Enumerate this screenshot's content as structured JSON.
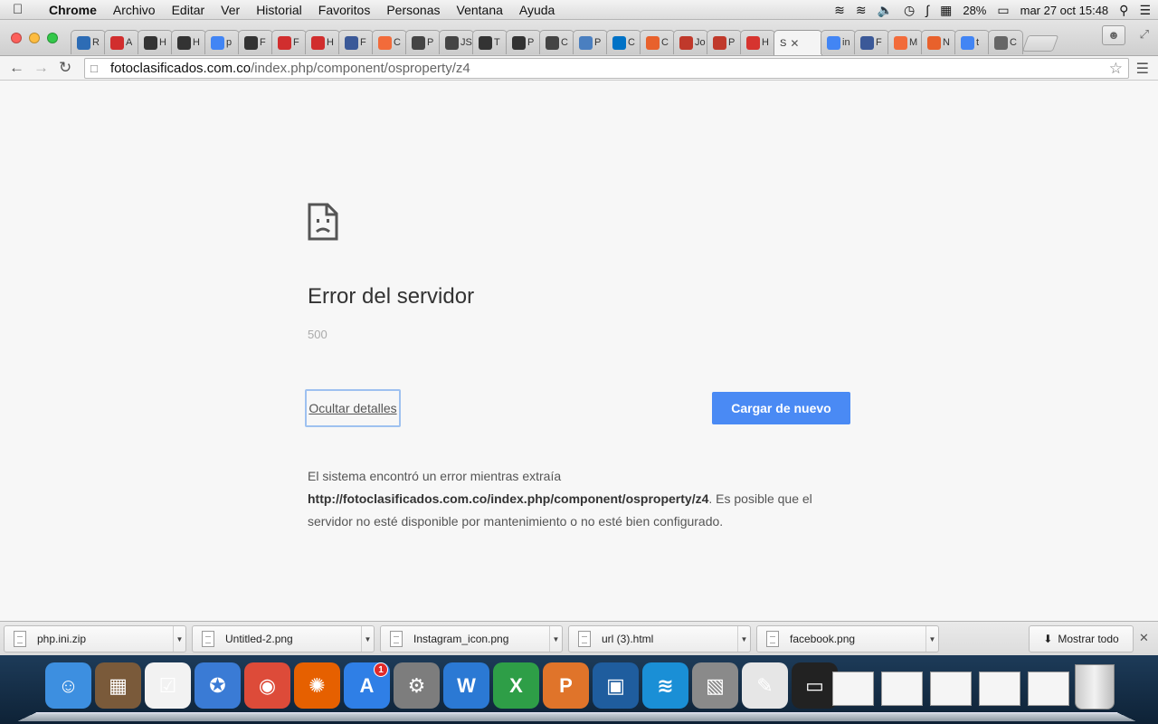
{
  "menubar": {
    "app_name": "Chrome",
    "items": [
      "Archivo",
      "Editar",
      "Ver",
      "Historial",
      "Favoritos",
      "Personas",
      "Ventana",
      "Ayuda"
    ],
    "status": {
      "battery": "28%",
      "datetime": "mar 27 oct  15:48"
    }
  },
  "tabs": [
    {
      "label": "R",
      "icon": "globe-icon",
      "color": "#2d6cb5"
    },
    {
      "label": "A",
      "icon": "pause-red-icon",
      "color": "#d12e2e"
    },
    {
      "label": "H",
      "icon": "joomla-icon",
      "color": "#333333"
    },
    {
      "label": "H",
      "icon": "joomla-icon",
      "color": "#333333"
    },
    {
      "label": "p",
      "icon": "google-icon",
      "color": "#4285f4"
    },
    {
      "label": "F",
      "icon": "joomla-icon",
      "color": "#333333"
    },
    {
      "label": "F",
      "icon": "pause-red-icon",
      "color": "#d12e2e"
    },
    {
      "label": "H",
      "icon": "pause-red-icon",
      "color": "#d12e2e"
    },
    {
      "label": "F",
      "icon": "facebook-icon",
      "color": "#3b5998"
    },
    {
      "label": "C",
      "icon": "joomla-color-icon",
      "color": "#f26b3a"
    },
    {
      "label": "P",
      "icon": "check-circle-icon",
      "color": "#444444"
    },
    {
      "label": "JS",
      "icon": "check-circle-icon",
      "color": "#444444"
    },
    {
      "label": "T",
      "icon": "joomla-icon",
      "color": "#333333"
    },
    {
      "label": "P",
      "icon": "joomla-icon",
      "color": "#333333"
    },
    {
      "label": "C",
      "icon": "check-circle-icon",
      "color": "#444444"
    },
    {
      "label": "P",
      "icon": "cloud-icon",
      "color": "#4a7fc0"
    },
    {
      "label": "C",
      "icon": "outlook-icon",
      "color": "#0072c6"
    },
    {
      "label": "C",
      "icon": "os-icon",
      "color": "#e8612c"
    },
    {
      "label": "Jo",
      "icon": "puzzle-icon",
      "color": "#c0392b"
    },
    {
      "label": "P",
      "icon": "puzzle-icon",
      "color": "#c0392b"
    },
    {
      "label": "H",
      "icon": "target-icon",
      "color": "#d6342f"
    },
    {
      "label": "S",
      "icon": "",
      "color": "#888888",
      "active": true
    },
    {
      "label": "in",
      "icon": "google-icon",
      "color": "#4285f4"
    },
    {
      "label": "F",
      "icon": "facebook-icon",
      "color": "#3b5998"
    },
    {
      "label": "M",
      "icon": "joomla-color-icon",
      "color": "#f26b3a"
    },
    {
      "label": "N",
      "icon": "os-icon",
      "color": "#e8612c"
    },
    {
      "label": "t",
      "icon": "google-icon",
      "color": "#4285f4"
    },
    {
      "label": "C",
      "icon": "apple-icon",
      "color": "#666666"
    }
  ],
  "address": {
    "host": "fotoclasificados.com.co",
    "path": "/index.php/component/osproperty/z4"
  },
  "error": {
    "title": "Error del servidor",
    "code": "500",
    "details_button": "Ocultar detalles",
    "reload_button": "Cargar de nuevo",
    "desc_prefix": "El sistema encontró un error mientras extraía ",
    "desc_url": "http://fotoclasificados.com.co/index.php/component/osproperty/z4",
    "desc_suffix": ". Es posible que el servidor no esté disponible por mantenimiento o no esté bien configurado."
  },
  "downloads": {
    "items": [
      "php.ini.zip",
      "Untitled-2.png",
      "Instagram_icon.png",
      "url (3).html",
      "facebook.png"
    ],
    "show_all": "Mostrar todo"
  },
  "dock": {
    "apps": [
      {
        "name": "finder",
        "color": "#3d8fe0",
        "glyph": "☺"
      },
      {
        "name": "photo-booth",
        "color": "#7a5a3a",
        "glyph": "▦"
      },
      {
        "name": "reminders",
        "color": "#f2f2f2",
        "glyph": "☑"
      },
      {
        "name": "safari",
        "color": "#3a7bd5",
        "glyph": "✪"
      },
      {
        "name": "chrome",
        "color": "#dd4b39",
        "glyph": "◉"
      },
      {
        "name": "firefox",
        "color": "#e66000",
        "glyph": "✺"
      },
      {
        "name": "app-store",
        "color": "#2f7fe6",
        "glyph": "A",
        "badge": "1"
      },
      {
        "name": "system-preferences",
        "color": "#7d7d7d",
        "glyph": "⚙"
      },
      {
        "name": "word",
        "color": "#2b79d4",
        "glyph": "W"
      },
      {
        "name": "excel",
        "color": "#2e9e47",
        "glyph": "X"
      },
      {
        "name": "powerpoint",
        "color": "#e0742a",
        "glyph": "P"
      },
      {
        "name": "virtualbox",
        "color": "#1f5d9e",
        "glyph": "▣"
      },
      {
        "name": "bose-connect",
        "color": "#1a8fd6",
        "glyph": "≋"
      },
      {
        "name": "preview",
        "color": "#8a8a8a",
        "glyph": "▧"
      },
      {
        "name": "textedit",
        "color": "#e6e6e6",
        "glyph": "✎"
      },
      {
        "name": "screen-capture",
        "color": "#222222",
        "glyph": "▭"
      }
    ]
  }
}
